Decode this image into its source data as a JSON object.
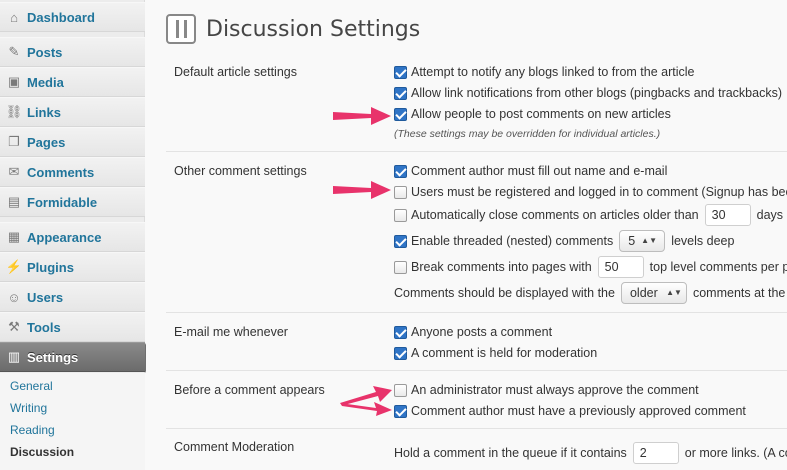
{
  "sidebar": {
    "items": [
      {
        "label": "Dashboard",
        "icon": "dashboard-icon",
        "glyph": "⌂"
      },
      {
        "label": "Posts",
        "icon": "posts-icon",
        "glyph": "✎"
      },
      {
        "label": "Media",
        "icon": "media-icon",
        "glyph": "▣"
      },
      {
        "label": "Links",
        "icon": "links-icon",
        "glyph": "⛓"
      },
      {
        "label": "Pages",
        "icon": "pages-icon",
        "glyph": "❐"
      },
      {
        "label": "Comments",
        "icon": "comments-icon",
        "glyph": "✉"
      },
      {
        "label": "Formidable",
        "icon": "formidable-icon",
        "glyph": "▤"
      },
      {
        "label": "Appearance",
        "icon": "appearance-icon",
        "glyph": "▦"
      },
      {
        "label": "Plugins",
        "icon": "plugins-icon",
        "glyph": "⚡"
      },
      {
        "label": "Users",
        "icon": "users-icon",
        "glyph": "☺"
      },
      {
        "label": "Tools",
        "icon": "tools-icon",
        "glyph": "⚒"
      },
      {
        "label": "Settings",
        "icon": "settings-icon",
        "glyph": "▥"
      }
    ],
    "submenu": [
      "General",
      "Writing",
      "Reading",
      "Discussion"
    ]
  },
  "page": {
    "title": "Discussion Settings"
  },
  "sections": {
    "default_article": {
      "label": "Default article settings",
      "opt1": "Attempt to notify any blogs linked to from the article",
      "opt2": "Allow link notifications from other blogs (pingbacks and trackbacks)",
      "opt3": "Allow people to post comments on new articles",
      "note": "(These settings may be overridden for individual articles.)"
    },
    "other_comment": {
      "label": "Other comment settings",
      "opt1": "Comment author must fill out name and e-mail",
      "opt2": "Users must be registered and logged in to comment (Signup has been",
      "opt3_pre": "Automatically close comments on articles older than",
      "opt3_value": "30",
      "opt3_post": "days",
      "opt4_pre": "Enable threaded (nested) comments",
      "opt4_value": "5",
      "opt4_post": "levels deep",
      "opt5_pre": "Break comments into pages with",
      "opt5_value": "50",
      "opt5_post": "top level comments per page",
      "opt6_pre": "Comments should be displayed with the",
      "opt6_value": "older",
      "opt6_post": "comments at the top"
    },
    "email_me": {
      "label": "E-mail me whenever",
      "opt1": "Anyone posts a comment",
      "opt2": "A comment is held for moderation"
    },
    "before_comment": {
      "label": "Before a comment appears",
      "opt1": "An administrator must always approve the comment",
      "opt2": "Comment author must have a previously approved comment"
    },
    "moderation": {
      "label": "Comment Moderation",
      "text_pre": "Hold a comment in the queue if it contains",
      "value": "2",
      "text_post": "or more links. (A common"
    }
  },
  "colors": {
    "link": "#21759b",
    "checkbox_on": "#2f74c6",
    "annotation_arrow": "#e8336b"
  }
}
